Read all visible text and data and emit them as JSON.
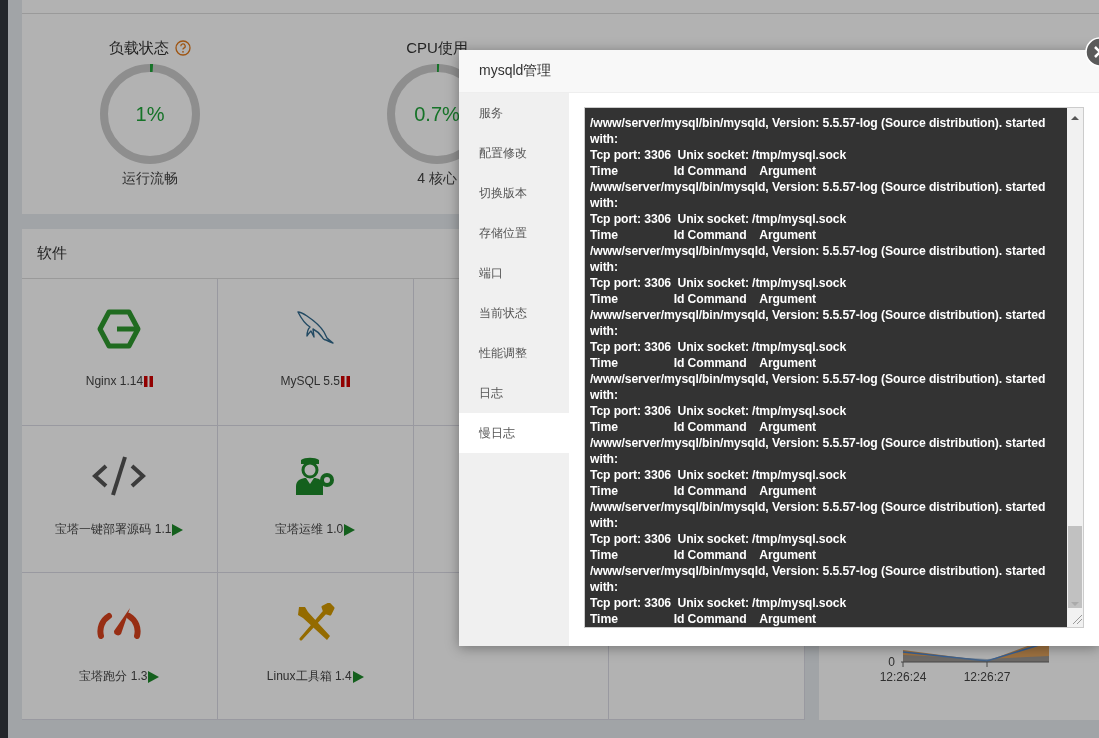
{
  "overview": {
    "gauges": [
      {
        "title": "负载状态",
        "help": true,
        "value": "1%",
        "level": 0.01,
        "caption": "运行流畅"
      },
      {
        "title": "CPU使用",
        "help": false,
        "value": "0.7%",
        "level": 0.007,
        "caption": "4 核心"
      }
    ]
  },
  "software": {
    "title": "软件",
    "rows": [
      [
        {
          "name": "Nginx 1.14",
          "kind": "nginx",
          "running": true
        },
        {
          "name": "MySQL 5.5",
          "kind": "mysql",
          "running": true
        }
      ],
      [
        {
          "name": "宝塔一键部署源码 1.1",
          "kind": "code",
          "running": false
        },
        {
          "name": "宝塔运维 1.0",
          "kind": "ops",
          "running": false
        }
      ],
      [
        {
          "name": "宝塔跑分 1.3",
          "kind": "speed",
          "running": false
        },
        {
          "name": "Linux工具箱 1.4",
          "kind": "tools",
          "running": false
        }
      ]
    ]
  },
  "traffic_chart": {
    "y_tick": "0",
    "x_labels": [
      "12:26:24",
      "12:26:27"
    ]
  },
  "modal": {
    "title": "mysqld管理",
    "menu": [
      {
        "label": "服务",
        "selected": false
      },
      {
        "label": "配置修改",
        "selected": false
      },
      {
        "label": "切换版本",
        "selected": false
      },
      {
        "label": "存储位置",
        "selected": false
      },
      {
        "label": "端口",
        "selected": false
      },
      {
        "label": "当前状态",
        "selected": false
      },
      {
        "label": "性能调整",
        "selected": false
      },
      {
        "label": "日志",
        "selected": false
      },
      {
        "label": "慢日志",
        "selected": true
      }
    ],
    "log_lines": [
      "/www/server/mysql/bin/mysqld, Version: 5.5.57-log (Source distribution). started",
      "with:",
      "Tcp port: 3306  Unix socket: /tmp/mysql.sock",
      "Time                 Id Command    Argument",
      "/www/server/mysql/bin/mysqld, Version: 5.5.57-log (Source distribution). started",
      "with:",
      "Tcp port: 3306  Unix socket: /tmp/mysql.sock",
      "Time                 Id Command    Argument",
      "/www/server/mysql/bin/mysqld, Version: 5.5.57-log (Source distribution). started",
      "with:",
      "Tcp port: 3306  Unix socket: /tmp/mysql.sock",
      "Time                 Id Command    Argument",
      "/www/server/mysql/bin/mysqld, Version: 5.5.57-log (Source distribution). started",
      "with:",
      "Tcp port: 3306  Unix socket: /tmp/mysql.sock",
      "Time                 Id Command    Argument",
      "/www/server/mysql/bin/mysqld, Version: 5.5.57-log (Source distribution). started",
      "with:",
      "Tcp port: 3306  Unix socket: /tmp/mysql.sock",
      "Time                 Id Command    Argument",
      "/www/server/mysql/bin/mysqld, Version: 5.5.57-log (Source distribution). started",
      "with:",
      "Tcp port: 3306  Unix socket: /tmp/mysql.sock",
      "Time                 Id Command    Argument",
      "/www/server/mysql/bin/mysqld, Version: 5.5.57-log (Source distribution). started",
      "with:",
      "Tcp port: 3306  Unix socket: /tmp/mysql.sock",
      "Time                 Id Command    Argument",
      "/www/server/mysql/bin/mysqld, Version: 5.5.57-log (Source distribution). started",
      "with:",
      "Tcp port: 3306  Unix socket: /tmp/mysql.sock",
      "Time                 Id Command    Argument"
    ]
  }
}
